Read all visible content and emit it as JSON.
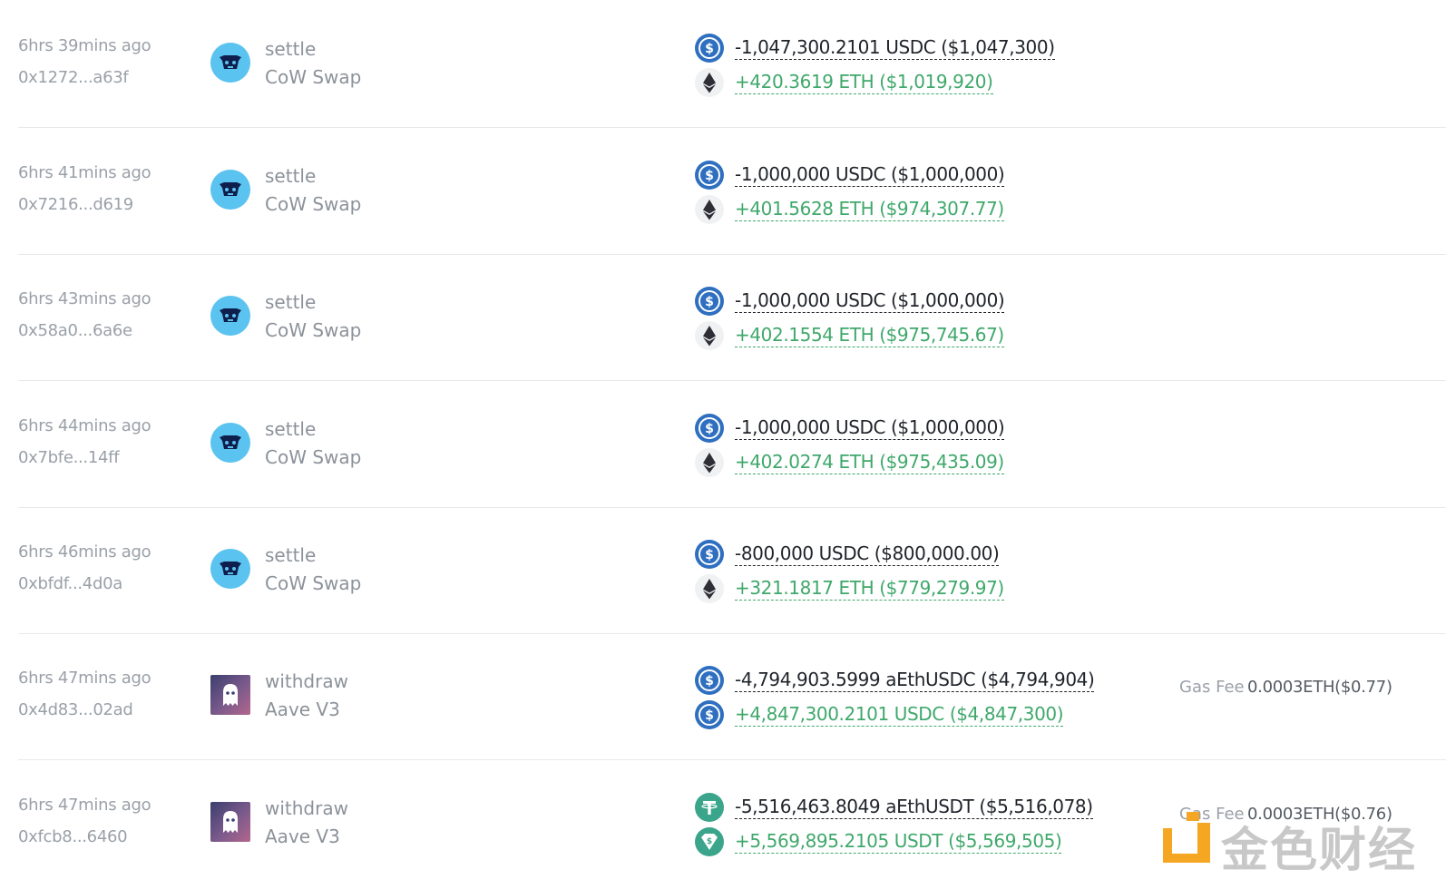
{
  "transactions": [
    {
      "time": "6hrs 39mins ago",
      "hash": "0x1272...a63f",
      "method": "settle",
      "protocol": "CoW Swap",
      "protocol_icon": "cow-icon",
      "out": {
        "token_icon": "usdc-icon",
        "text": "-1,047,300.2101 USDC ($1,047,300)"
      },
      "in": {
        "token_icon": "eth-icon",
        "text": "+420.3619 ETH ($1,019,920)"
      }
    },
    {
      "time": "6hrs 41mins ago",
      "hash": "0x7216...d619",
      "method": "settle",
      "protocol": "CoW Swap",
      "protocol_icon": "cow-icon",
      "out": {
        "token_icon": "usdc-icon",
        "text": "-1,000,000 USDC ($1,000,000)"
      },
      "in": {
        "token_icon": "eth-icon",
        "text": "+401.5628 ETH ($974,307.77)"
      }
    },
    {
      "time": "6hrs 43mins ago",
      "hash": "0x58a0...6a6e",
      "method": "settle",
      "protocol": "CoW Swap",
      "protocol_icon": "cow-icon",
      "out": {
        "token_icon": "usdc-icon",
        "text": "-1,000,000 USDC ($1,000,000)"
      },
      "in": {
        "token_icon": "eth-icon",
        "text": "+402.1554 ETH ($975,745.67)"
      }
    },
    {
      "time": "6hrs 44mins ago",
      "hash": "0x7bfe...14ff",
      "method": "settle",
      "protocol": "CoW Swap",
      "protocol_icon": "cow-icon",
      "out": {
        "token_icon": "usdc-icon",
        "text": "-1,000,000 USDC ($1,000,000)"
      },
      "in": {
        "token_icon": "eth-icon",
        "text": "+402.0274 ETH ($975,435.09)"
      }
    },
    {
      "time": "6hrs 46mins ago",
      "hash": "0xbfdf...4d0a",
      "method": "settle",
      "protocol": "CoW Swap",
      "protocol_icon": "cow-icon",
      "out": {
        "token_icon": "usdc-icon",
        "text": "-800,000 USDC ($800,000.00)"
      },
      "in": {
        "token_icon": "eth-icon",
        "text": "+321.1817 ETH ($779,279.97)"
      }
    },
    {
      "time": "6hrs 47mins ago",
      "hash": "0x4d83...02ad",
      "method": "withdraw",
      "protocol": "Aave V3",
      "protocol_icon": "aave-ghost-icon",
      "out": {
        "token_icon": "usdc-icon",
        "text": "-4,794,903.5999 aEthUSDC ($4,794,904)"
      },
      "in": {
        "token_icon": "usdc-icon",
        "text": "+4,847,300.2101 USDC ($4,847,300)"
      },
      "gas_label": "Gas Fee",
      "gas_value": "0.0003ETH($0.77)"
    },
    {
      "time": "6hrs 47mins ago",
      "hash": "0xfcb8...6460",
      "method": "withdraw",
      "protocol": "Aave V3",
      "protocol_icon": "aave-ghost-icon",
      "out": {
        "token_icon": "usdt-icon",
        "text": "-5,516,463.8049 aEthUSDT ($5,516,078)"
      },
      "in": {
        "token_icon": "usdt-icon",
        "text": "+5,569,895.2105 USDT ($5,569,505)"
      },
      "gas_label": "Gas Fee",
      "gas_value": "0.0003ETH($0.76)"
    }
  ],
  "watermark": {
    "text": "金色财经",
    "logo_icon": "jinse-logo-icon"
  },
  "colors": {
    "positive": "#3fa86b",
    "negative": "#1f2329",
    "muted": "#9aa0a8",
    "usdc": "#2f6fc0",
    "usdt": "#3aa58b",
    "cow": "#5bc3f0"
  }
}
